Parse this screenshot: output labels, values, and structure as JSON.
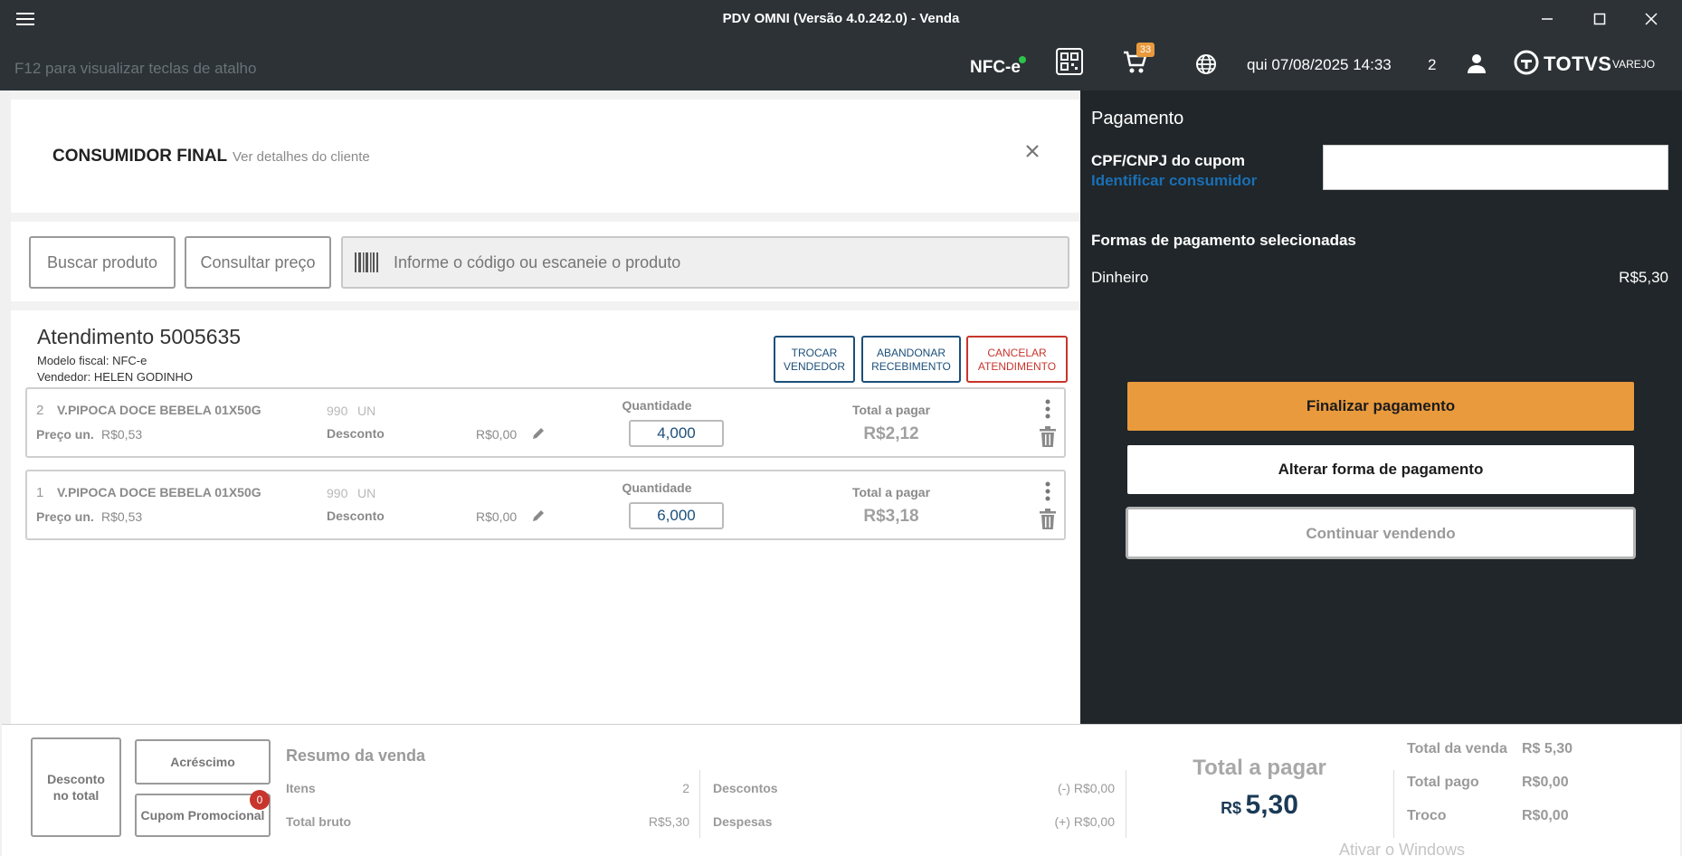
{
  "window": {
    "title": "PDV OMNI (Versão 4.0.242.0) - Venda"
  },
  "header": {
    "shortcut_hint": "F12 para visualizar teclas de atalho",
    "nfce_label": "NFC-e",
    "cart_badge": "33",
    "datetime": "qui 07/08/2025 14:33",
    "user_count": "2",
    "brand": "TOTVS",
    "brand_sub": "VAREJO"
  },
  "customer": {
    "name": "CONSUMIDOR FINAL",
    "details_link": "Ver detalhes do cliente"
  },
  "search": {
    "buscar_label": "Buscar produto",
    "consultar_label": "Consultar preço",
    "placeholder": "Informe o código ou escaneie o produto"
  },
  "attendance": {
    "title": "Atendimento 5005635",
    "fiscal_model": "Modelo fiscal: NFC-e",
    "seller": "Vendedor: HELEN GODINHO",
    "trocar_line1": "TROCAR",
    "trocar_line2": "VENDEDOR",
    "abandonar_line1": "ABANDONAR",
    "abandonar_line2": "RECEBIMENTO",
    "cancelar_line1": "CANCELAR",
    "cancelar_line2": "ATENDIMENTO"
  },
  "items": [
    {
      "seq": "2",
      "name": "V.PIPOCA DOCE BEBELA 01X50G",
      "code": "990",
      "unit": "UN",
      "price_label": "Preço un.",
      "price": "R$0,53",
      "discount_label": "Desconto",
      "discount": "R$0,00",
      "qty_label": "Quantidade",
      "qty": "4,000",
      "total_label": "Total a pagar",
      "total": "R$2,12"
    },
    {
      "seq": "1",
      "name": "V.PIPOCA DOCE BEBELA 01X50G",
      "code": "990",
      "unit": "UN",
      "price_label": "Preço un.",
      "price": "R$0,53",
      "discount_label": "Desconto",
      "discount": "R$0,00",
      "qty_label": "Quantidade",
      "qty": "6,000",
      "total_label": "Total a pagar",
      "total": "R$3,18"
    }
  ],
  "payment": {
    "title": "Pagamento",
    "cpf_label": "CPF/CNPJ do cupom",
    "identify_link": "Identificar consumidor",
    "cpf_value": "",
    "forms_title": "Formas de pagamento selecionadas",
    "method": "Dinheiro",
    "method_value": "R$5,30",
    "finalize": "Finalizar pagamento",
    "change_method": "Alterar forma de pagamento",
    "continue": "Continuar vendendo"
  },
  "summary": {
    "desconto_total": "Desconto no total",
    "acrescimo": "Acréscimo",
    "cupom": "Cupom Promocional",
    "cupom_badge": "0",
    "title": "Resumo da venda",
    "itens_label": "Itens",
    "itens_value": "2",
    "bruto_label": "Total bruto",
    "bruto_value": "R$5,30",
    "descontos_label": "Descontos",
    "descontos_value": "(-) R$0,00",
    "despesas_label": "Despesas",
    "despesas_value": "(+) R$0,00",
    "total_pagar_label": "Total a pagar",
    "currency": "R$",
    "total_pagar_value": "5,30",
    "total_venda_label": "Total da venda",
    "total_venda_value": "R$ 5,30",
    "total_pago_label": "Total pago",
    "total_pago_value": "R$0,00",
    "troco_label": "Troco",
    "troco_value": "R$0,00",
    "watermark": "Ativar o Windows"
  },
  "colors": {
    "dark_bg": "#2c3236",
    "panel_bg": "#202629",
    "accent_orange": "#e99a3c",
    "link_blue": "#1a6fb5",
    "navy": "#1b4f7a",
    "danger_red": "#c8352c"
  }
}
